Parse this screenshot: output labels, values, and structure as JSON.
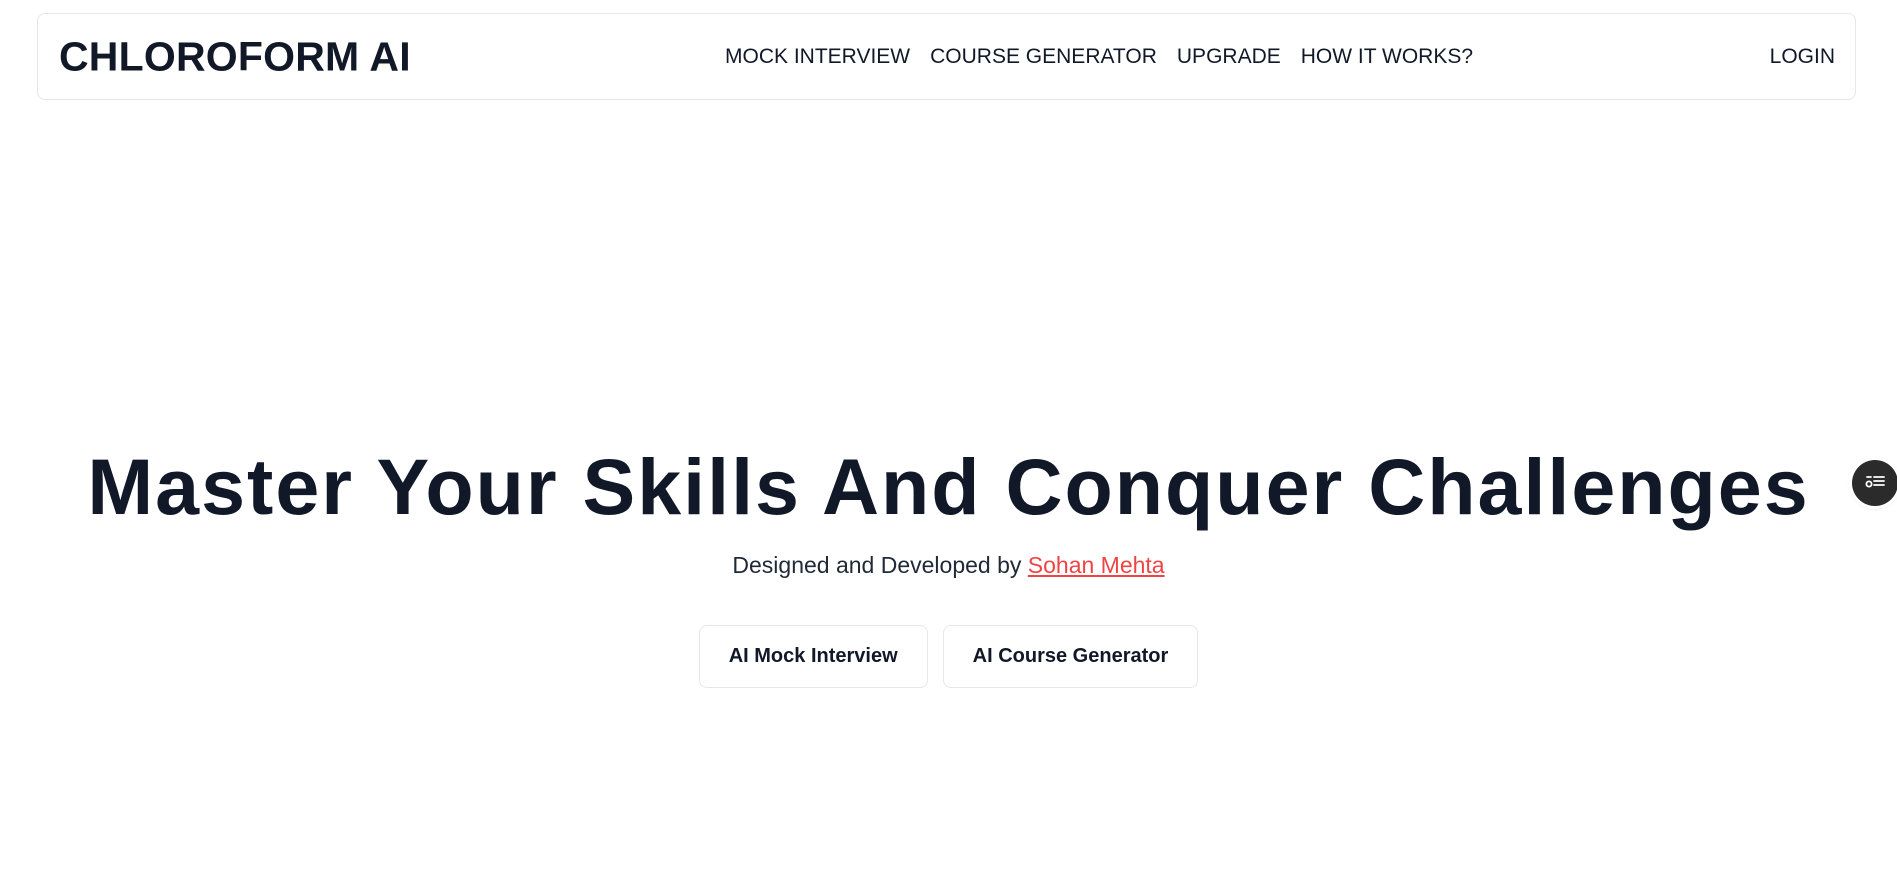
{
  "navbar": {
    "brand": "CHLOROFORM AI",
    "links": [
      {
        "label": "MOCK INTERVIEW"
      },
      {
        "label": "COURSE GENERATOR"
      },
      {
        "label": "UPGRADE"
      },
      {
        "label": "HOW IT WORKS?"
      }
    ],
    "login_label": "LOGIN"
  },
  "hero": {
    "title": "Master Your Skills And Conquer Challenges",
    "subtitle_prefix": "Designed and Developed by ",
    "author_link": "Sohan Mehta",
    "buttons": [
      {
        "label": "AI Mock Interview"
      },
      {
        "label": "AI Course Generator"
      }
    ]
  },
  "floating_button": {
    "icon": "settings-list-icon"
  },
  "colors": {
    "text": "#111827",
    "accent_link": "#ef4444",
    "border": "#e5e7eb",
    "fab": "#2b2b2b"
  }
}
